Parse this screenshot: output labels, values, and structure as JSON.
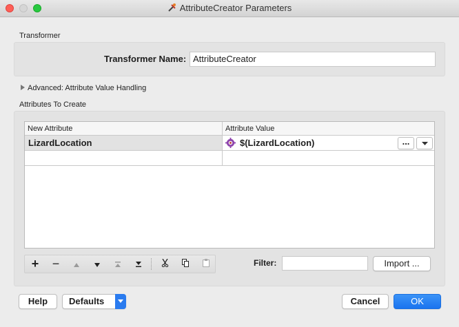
{
  "window": {
    "title": "AttributeCreator Parameters",
    "controls": {
      "close": "close-icon",
      "minimize": "minimize-icon",
      "maximize": "maximize-icon"
    }
  },
  "transformer": {
    "group_label": "Transformer",
    "name_label": "Transformer Name:",
    "name_value": "AttributeCreator"
  },
  "advanced": {
    "label": "Advanced: Attribute Value Handling"
  },
  "attributes": {
    "group_label": "Attributes To Create",
    "columns": [
      "New Attribute",
      "Attribute Value"
    ],
    "rows": [
      {
        "name": "LizardLocation",
        "value": "$(LizardLocation)"
      },
      {
        "name": "",
        "value": ""
      }
    ],
    "ellipsis_label": "..."
  },
  "toolbar": {
    "add": "+",
    "remove": "−",
    "icons": [
      "add-icon",
      "remove-icon",
      "move-up-icon",
      "move-down-icon",
      "move-top-icon",
      "move-bottom-icon",
      "cut-icon",
      "copy-icon",
      "paste-icon"
    ]
  },
  "filter": {
    "label": "Filter:",
    "value": ""
  },
  "import_label": "Import ...",
  "footer": {
    "help": "Help",
    "defaults": "Defaults",
    "cancel": "Cancel",
    "ok": "OK"
  },
  "colors": {
    "accent": "#1a74ef",
    "close": "#fe5f57",
    "maximize": "#28c840"
  }
}
